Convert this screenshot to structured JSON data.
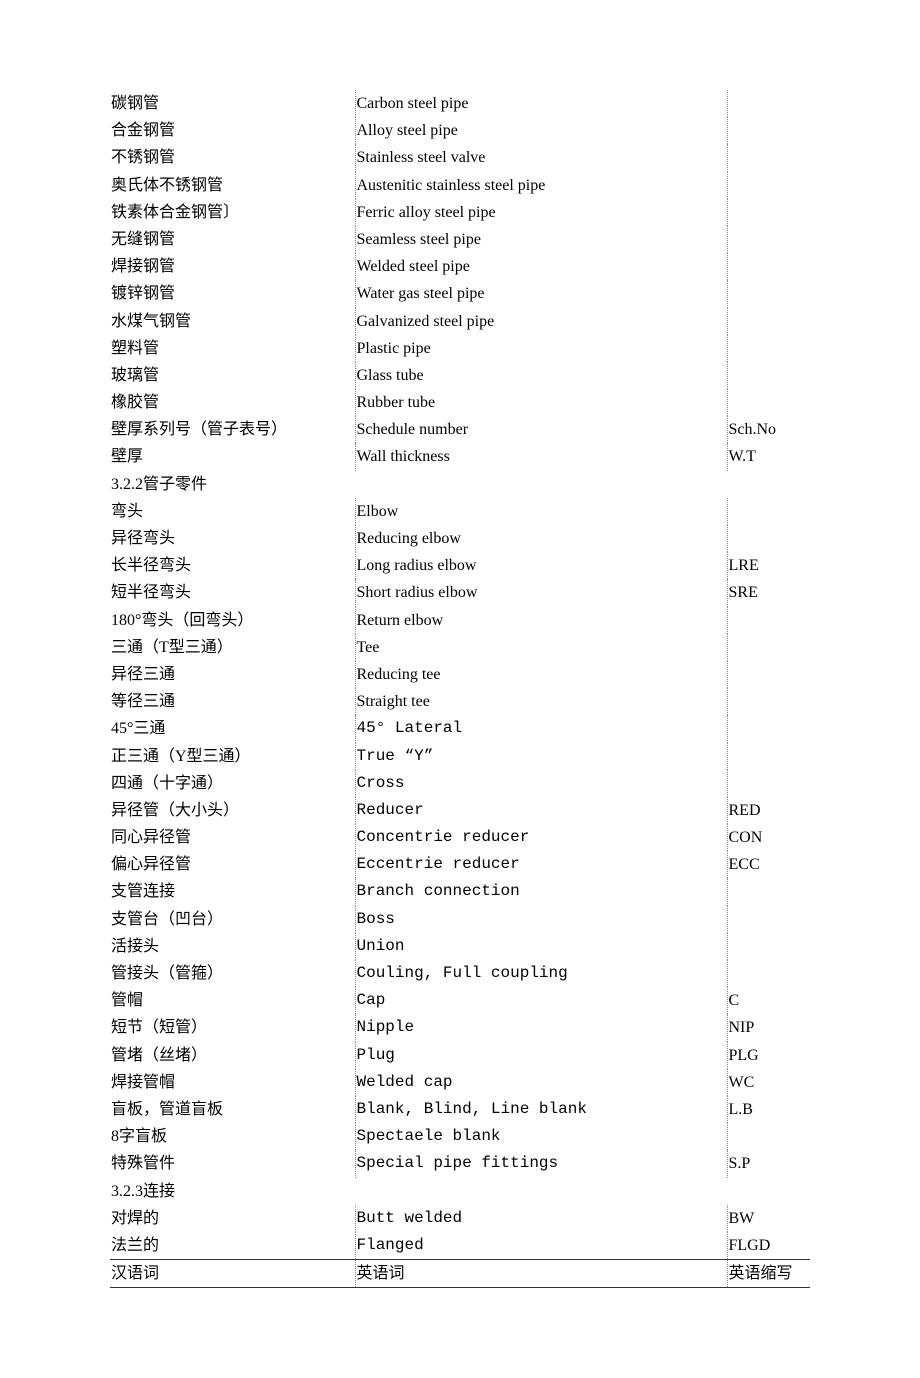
{
  "rows": [
    {
      "zh": "碳钢管",
      "en": "Carbon steel pipe",
      "ab": "",
      "enClass": "eng"
    },
    {
      "zh": "合金钢管",
      "en": "Alloy steel pipe",
      "ab": "",
      "enClass": "eng"
    },
    {
      "zh": "不锈钢管",
      "en": "Stainless steel valve",
      "ab": "",
      "enClass": "eng"
    },
    {
      "zh": "奥氏体不锈钢管",
      "en": "Austenitic stainless steel pipe",
      "ab": "",
      "enClass": "eng"
    },
    {
      "zh": "铁素体合金钢管〕",
      "en": "Ferric alloy steel pipe",
      "ab": "",
      "enClass": "eng"
    },
    {
      "zh": "无缝钢管",
      "en": "Seamless steel pipe",
      "ab": "",
      "enClass": "eng"
    },
    {
      "zh": "焊接钢管",
      "en": "Welded steel pipe",
      "ab": "",
      "enClass": "eng"
    },
    {
      "zh": "镀锌钢管",
      "en": "Water gas steel pipe",
      "ab": "",
      "enClass": "eng"
    },
    {
      "zh": "水煤气钢管",
      "en": "Galvanized steel pipe",
      "ab": "",
      "enClass": "eng"
    },
    {
      "zh": "塑料管",
      "en": "Plastic pipe",
      "ab": "",
      "enClass": "eng"
    },
    {
      "zh": "玻璃管",
      "en": "Glass tube",
      "ab": "",
      "enClass": "eng"
    },
    {
      "zh": "橡胶管",
      "en": "Rubber tube",
      "ab": "",
      "enClass": "eng"
    },
    {
      "zh": "壁厚系列号（管子表号）",
      "en": "Schedule number",
      "ab": "Sch.No",
      "enClass": "eng"
    },
    {
      "zh": "壁厚",
      "en": "Wall thickness",
      "ab": "W.T",
      "enClass": "eng"
    },
    {
      "zh": "3.2.2管子零件",
      "section": true
    },
    {
      "zh": "弯头",
      "en": "Elbow",
      "ab": "",
      "enClass": "eng"
    },
    {
      "zh": "异径弯头",
      "en": "Reducing elbow",
      "ab": "",
      "enClass": "eng"
    },
    {
      "zh": "长半径弯头",
      "en": "Long radius elbow",
      "ab": "LRE",
      "enClass": "eng"
    },
    {
      "zh": "短半径弯头",
      "en": "Short radius elbow",
      "ab": "SRE",
      "enClass": "eng"
    },
    {
      "zh": "180°弯头（回弯头）",
      "en": "Return elbow",
      "ab": "",
      "enClass": "eng"
    },
    {
      "zh": "三通（T型三通）",
      "en": "Tee",
      "ab": "",
      "enClass": "eng"
    },
    {
      "zh": "异径三通",
      "en": "Reducing tee",
      "ab": "",
      "enClass": "eng"
    },
    {
      "zh": "等径三通",
      "en": "Straight tee",
      "ab": "",
      "enClass": "eng"
    },
    {
      "zh": "45°三通",
      "en": "45° Lateral",
      "ab": "",
      "enClass": "tt"
    },
    {
      "zh": "正三通（Y型三通）",
      "en": "True “Y”",
      "ab": "",
      "enClass": "tt"
    },
    {
      "zh": "四通（十字通）",
      "en": "Cross",
      "ab": "",
      "enClass": "tt"
    },
    {
      "zh": "异径管（大小头）",
      "en": "Reducer",
      "ab": "RED",
      "enClass": "tt"
    },
    {
      "zh": "同心异径管",
      "en": "Concentrie reducer",
      "ab": "CON",
      "enClass": "tt"
    },
    {
      "zh": "偏心异径管",
      "en": "Eccentrie reducer",
      "ab": "ECC",
      "enClass": "tt"
    },
    {
      "zh": "支管连接",
      "en": "Branch connection",
      "ab": "",
      "enClass": "tt"
    },
    {
      "zh": "支管台（凹台）",
      "en": "Boss",
      "ab": "",
      "enClass": "tt"
    },
    {
      "zh": "活接头",
      "en": "Union",
      "ab": "",
      "enClass": "tt"
    },
    {
      "zh": "管接头（管箍）",
      "en": "Couling, Full coupling",
      "ab": "",
      "enClass": "tt"
    },
    {
      "zh": "管帽",
      "en": "Cap",
      "ab": "C",
      "enClass": "tt"
    },
    {
      "zh": "短节（短管）",
      "en": "Nipple",
      "ab": "NIP",
      "enClass": "tt"
    },
    {
      "zh": "管堵（丝堵）",
      "en": "Plug",
      "ab": "PLG",
      "enClass": "tt"
    },
    {
      "zh": "焊接管帽",
      "en": "Welded cap",
      "ab": "WC",
      "enClass": "tt"
    },
    {
      "zh": "盲板，管道盲板",
      "en": "Blank, Blind, Line blank",
      "ab": "L.B",
      "enClass": "tt"
    },
    {
      "zh": "8字盲板",
      "en": "Spectaele blank",
      "ab": "",
      "enClass": "tt"
    },
    {
      "zh": "特殊管件",
      "en": "Special pipe fittings",
      "ab": "S.P",
      "enClass": "tt"
    },
    {
      "zh": "3.2.3连接",
      "section": true
    },
    {
      "zh": "对焊的",
      "en": "Butt welded",
      "ab": "BW",
      "enClass": "tt"
    },
    {
      "zh": "法兰的",
      "en": "Flanged",
      "ab": "FLGD",
      "enClass": "tt",
      "prehdr": true
    }
  ],
  "header": {
    "zh": "汉语词",
    "en": "英语词",
    "ab": "英语缩写"
  }
}
